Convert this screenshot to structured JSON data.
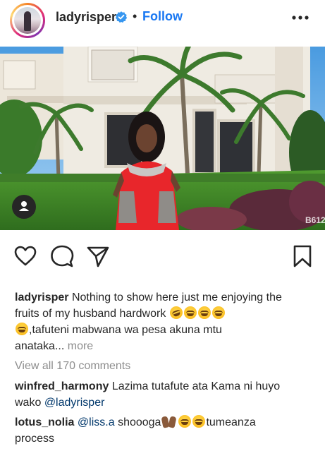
{
  "post": {
    "username": "ladyrisper",
    "follow_label": "Follow",
    "separator": "•"
  },
  "caption": {
    "username": "ladyrisper",
    "line1": "Nothing to show here just me enjoying the",
    "line2": "fruits of my husband hardwork",
    "line3": ",tafuteni mabwana wa pesa akuna mtu",
    "line4": "anataka...",
    "more_label": "more"
  },
  "comments": {
    "view_all_label": "View all 170 comments",
    "items": [
      {
        "username": "winfred_harmony",
        "text": "Lazima tutafute ata Kama ni huyo",
        "text2": "wako",
        "mention": "@ladyrisper"
      },
      {
        "username": "lotus_nolia",
        "mention": "@liss.a",
        "text": "shoooga",
        "text_after": "tumeanza",
        "text2": "process"
      }
    ]
  },
  "photo": {
    "watermark": "B612"
  },
  "icons": {
    "verified": "verified-badge-icon",
    "more": "more-options-icon",
    "like": "heart-icon",
    "comment": "comment-icon",
    "share": "share-icon",
    "save": "bookmark-icon",
    "user_tag": "user-tag-icon"
  },
  "colors": {
    "follow": "#1877f2",
    "mention": "#00376b",
    "muted": "#8e8e8e",
    "text": "#262626",
    "dress": "#e8262b"
  }
}
